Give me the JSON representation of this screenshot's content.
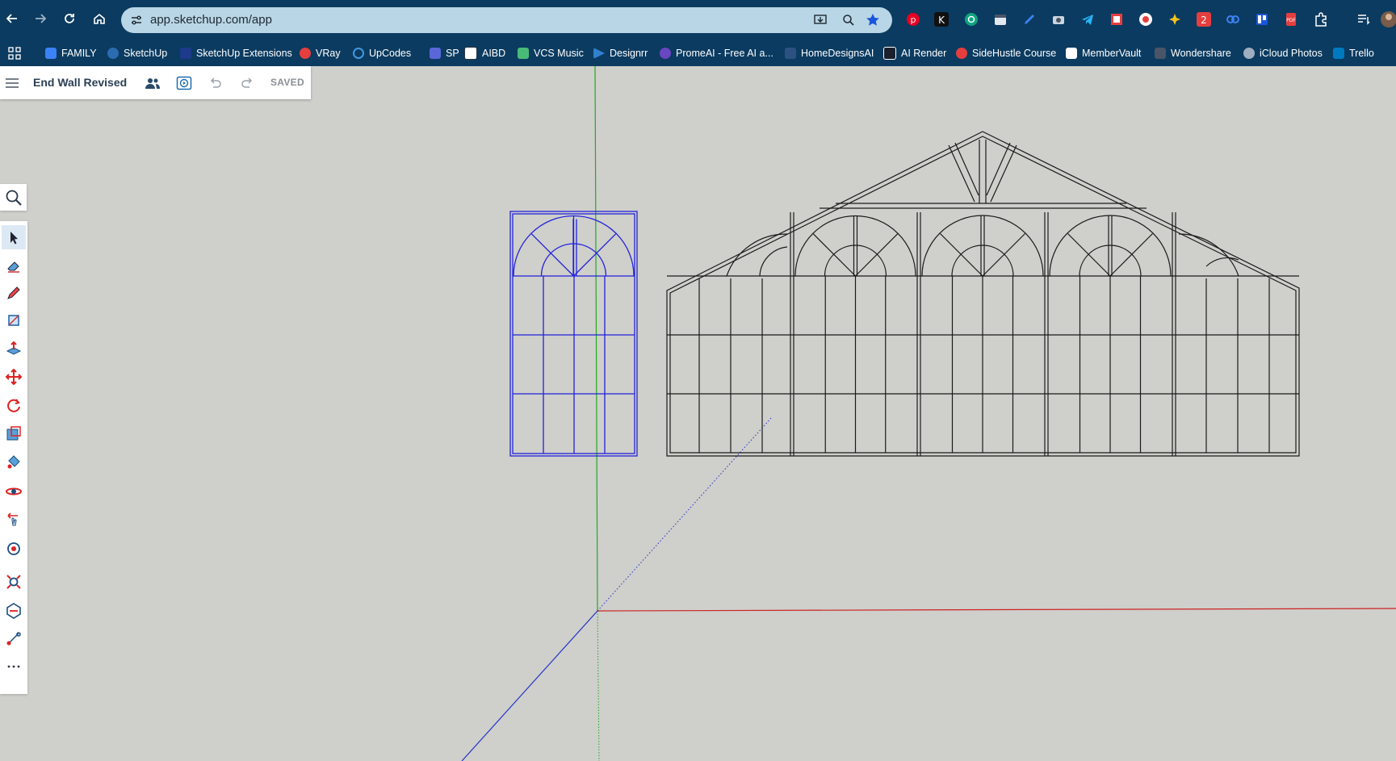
{
  "browser": {
    "url": "app.sketchup.com/app",
    "bookmarks": [
      {
        "label": "FAMILY",
        "color": "#3b82f6"
      },
      {
        "label": "SketchUp",
        "color": "#2b6cb0"
      },
      {
        "label": "SketchUp Extensions",
        "color": "#1e3a8a"
      },
      {
        "label": "VRay",
        "color": "#e53e3e"
      },
      {
        "label": "UpCodes",
        "color": "#4299e1"
      },
      {
        "label": "SP",
        "color": "#5a67d8"
      },
      {
        "label": "AIBD",
        "color": "#2d3748"
      },
      {
        "label": "VCS Music",
        "color": "#48bb78"
      },
      {
        "label": "Designrr",
        "color": "#3182ce"
      },
      {
        "label": "PromeAI - Free AI a...",
        "color": "#6b46c1"
      },
      {
        "label": "HomeDesignsAI",
        "color": "#2c5282"
      },
      {
        "label": "AI Render",
        "color": "#1a202c"
      },
      {
        "label": "SideHustle Course",
        "color": "#e53e3e"
      },
      {
        "label": "MemberVault",
        "color": "#ffffff"
      },
      {
        "label": "Wondershare",
        "color": "#4a5568"
      },
      {
        "label": "iCloud Photos",
        "color": "#a0aec0"
      },
      {
        "label": "Trello",
        "color": "#0079bf"
      }
    ]
  },
  "app": {
    "document_title": "End Wall Revised",
    "save_status": "SAVED"
  },
  "tools": [
    {
      "icon": "select-arrow-icon",
      "active": true
    },
    {
      "icon": "eraser-icon",
      "active": false
    },
    {
      "icon": "pencil-line-icon",
      "active": false
    },
    {
      "icon": "rectangle-icon",
      "active": false
    },
    {
      "icon": "push-pull-icon",
      "active": false
    },
    {
      "icon": "move-icon",
      "active": false
    },
    {
      "icon": "rotate-icon",
      "active": false
    },
    {
      "icon": "scale-icon",
      "active": false
    },
    {
      "icon": "paint-bucket-icon",
      "active": false
    },
    {
      "icon": "orbit-icon",
      "active": false
    },
    {
      "icon": "pan-icon",
      "active": false
    },
    {
      "icon": "look-around-icon",
      "active": false
    },
    {
      "icon": "zoom-extents-icon",
      "active": false
    },
    {
      "icon": "section-plane-icon",
      "active": false
    },
    {
      "icon": "tape-measure-icon",
      "active": false
    },
    {
      "icon": "more-tools-icon",
      "active": false
    }
  ],
  "colors": {
    "selection": "#2222dd",
    "model_lines": "#1a1a1a",
    "axis_red": "#cc2222",
    "axis_green": "#22aa22",
    "axis_blue": "#2233cc",
    "canvas": "#cfcfcb"
  }
}
